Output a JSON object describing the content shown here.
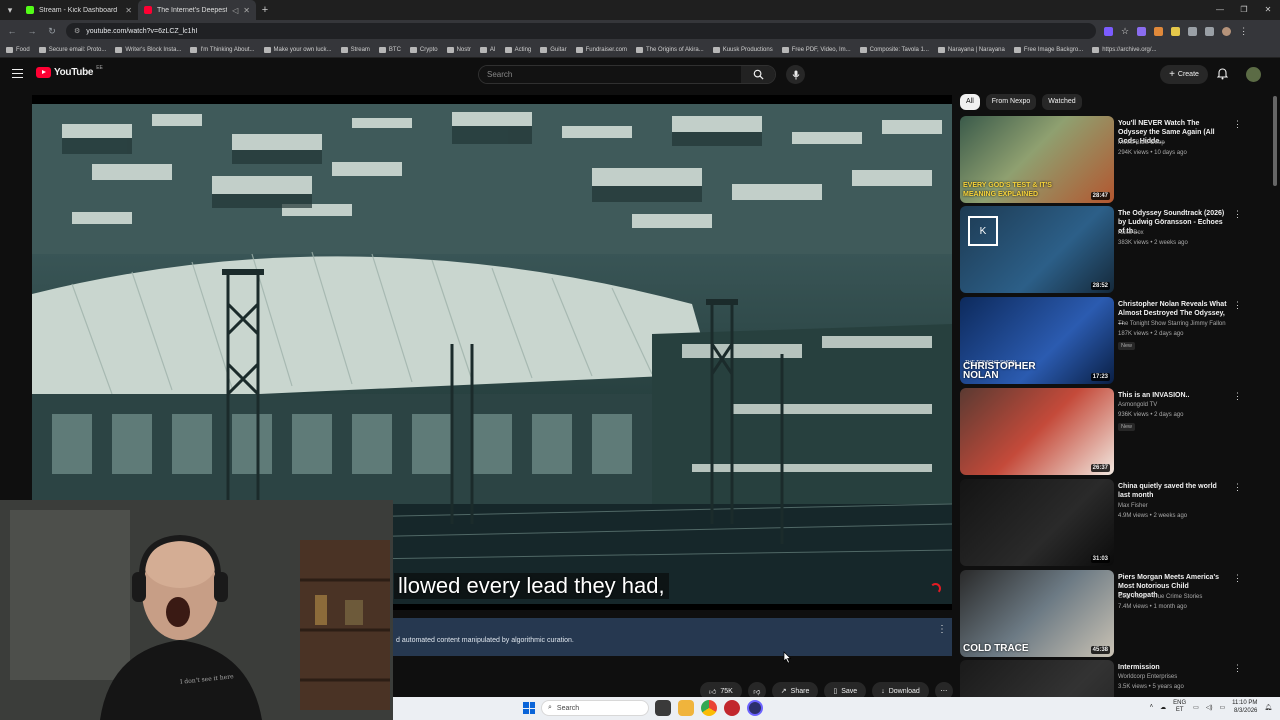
{
  "browser": {
    "tabs": [
      {
        "title": "Stream - Kick Dashboard",
        "favicon_color": "#53fc18"
      },
      {
        "title": "The Internet's Deepest Rab",
        "favicon_color": "#ff0033"
      }
    ],
    "url": "youtube.com/watch?v=6zLCZ_lc1hI",
    "bookmarks": [
      "Food",
      "Secure email: Proto...",
      "Writer's Block Insta...",
      "I'm Thinking About...",
      "Make your own luck...",
      "Stream",
      "BTC",
      "Crypto",
      "Nostr",
      "AI",
      "Acting",
      "Guitar",
      "Fundraiser.com",
      "The Origins of Akira...",
      "Kuusk Productions",
      "Free PDF, Video, Im...",
      "Composite: Tavola 1...",
      "Narayana | Narayana",
      "Free Image Backgro...",
      "https://archive.org/..."
    ]
  },
  "header": {
    "logo_text": "YouTube",
    "logo_suffix": "EE",
    "search_placeholder": "Search",
    "create_label": "Create"
  },
  "player": {
    "caption": "llowed every lead they had,",
    "info_text": "d automated content manipulated by algorithmic curation."
  },
  "actions": {
    "likes": "75K",
    "share": "Share",
    "save": "Save",
    "download": "Download"
  },
  "sidebar": {
    "chips": [
      "All",
      "From Nexpo",
      "Watched"
    ],
    "videos": [
      {
        "title": "You'll NEVER Watch The Odyssey the Same Again (All Gods, Hidde...",
        "channel": "Movie Balls Deep",
        "meta": "294K views • 10 days ago",
        "duration": "28:47",
        "thumb_text": "EVERY GOD'S TEST & IT'S MEANING EXPLAINED",
        "badge": ""
      },
      {
        "title": "The Odyssey Soundtrack (2026) by Ludwig Göransson - Echoes of th...",
        "channel": "Kaka Box",
        "meta": "383K views • 2 weeks ago",
        "duration": "28:52",
        "thumb_text": "",
        "badge": ""
      },
      {
        "title": "Christopher Nolan Reveals What Almost Destroyed The Odyssey, ...",
        "channel": "The Tonight Show Starring Jimmy Fallon",
        "meta": "187K views • 2 days ago",
        "duration": "17:23",
        "thumb_text": "CHRISTOPHER NOLAN",
        "thumb_small": "THE TONIGHT SHOW",
        "badge": "New"
      },
      {
        "title": "This is an INVASION..",
        "channel": "Asmongold TV",
        "meta": "936K views • 2 days ago",
        "duration": "26:37",
        "thumb_text": "",
        "badge": "New"
      },
      {
        "title": "China quietly saved the world last month",
        "channel": "Max Fisher",
        "meta": "4.9M views • 2 weeks ago",
        "duration": "31:03",
        "thumb_text": "",
        "badge": ""
      },
      {
        "title": "Piers Morgan Meets America's Most Notorious Child Psychopath",
        "channel": "Cold Trace - True Crime Stories",
        "meta": "7.4M views • 1 month ago",
        "duration": "45:38",
        "thumb_text": "COLD TRACE",
        "badge": ""
      },
      {
        "title": "Intermission",
        "channel": "Worldcorp Enterprises",
        "meta": "3.5K views • 5 years ago",
        "duration": "",
        "thumb_text": "",
        "badge": ""
      }
    ]
  },
  "taskbar": {
    "search_placeholder": "Search",
    "lang_top": "ENG",
    "lang_bottom": "ET",
    "time": "11:10 PM",
    "date": "8/3/2026"
  },
  "webcam": {
    "shirt_text": "I don't see it here"
  }
}
